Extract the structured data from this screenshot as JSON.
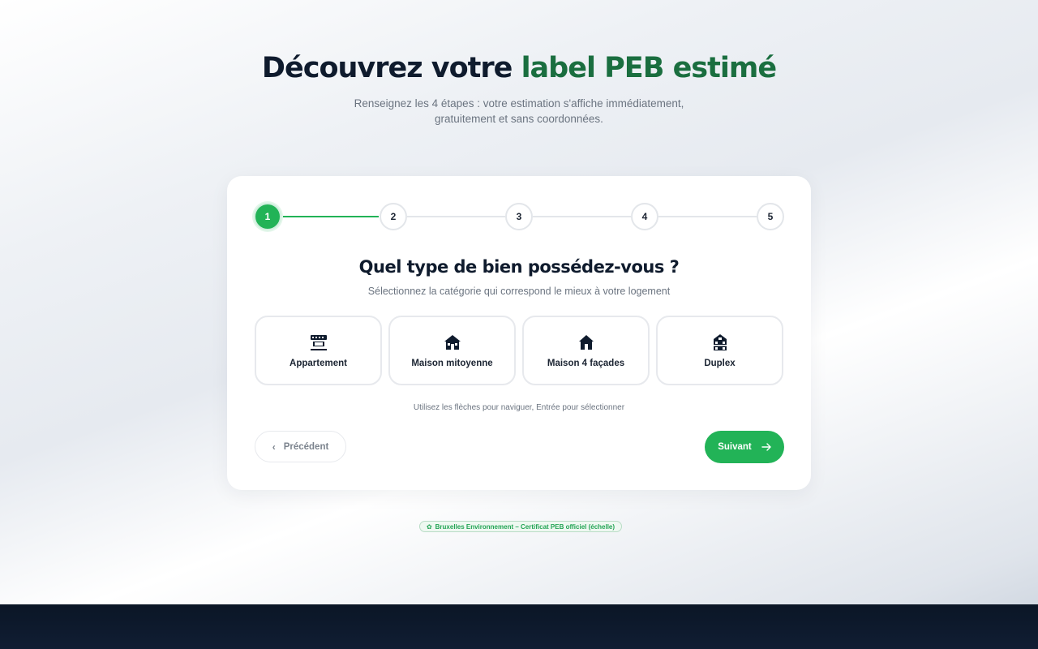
{
  "hero": {
    "title_main": "Découvrez votre ",
    "title_accent": "label PEB estimé",
    "subtitle": "Renseignez les 4 étapes : votre estimation s'affiche immédiatement, gratuitement et sans coordonnées."
  },
  "stepper": {
    "steps": [
      "1",
      "2",
      "3",
      "4",
      "5"
    ],
    "current": 1
  },
  "question": {
    "title": "Quel type de bien possédez-vous ?",
    "subtitle": "Sélectionnez la catégorie qui correspond le mieux à votre logement"
  },
  "options": [
    {
      "label": "Appartement",
      "icon": "apartment-icon"
    },
    {
      "label": "Maison mitoyenne",
      "icon": "house-icon"
    },
    {
      "label": "Maison 4 façades",
      "icon": "detached-house-icon"
    },
    {
      "label": "Duplex",
      "icon": "duplex-icon"
    }
  ],
  "hint": "Utilisez les flèches pour naviguer, Entrée pour sélectionner",
  "nav": {
    "prev_label": "Précédent",
    "next_label": "Suivant"
  },
  "badge": {
    "text": "Bruxelles Environnement – Certificat PEB officiel (échelle)"
  },
  "colors": {
    "accent": "#22b357",
    "accent_dark": "#1a6e3f",
    "text_dark": "#0f1b2d"
  }
}
